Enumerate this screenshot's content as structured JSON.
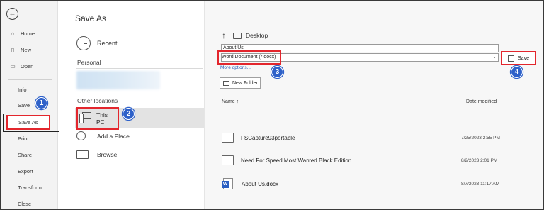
{
  "nav": {
    "items": [
      {
        "label": "Home",
        "icon": "home-icon",
        "glyph": "⌂"
      },
      {
        "label": "New",
        "icon": "new-document-icon",
        "glyph": "▯"
      },
      {
        "label": "Open",
        "icon": "open-folder-icon",
        "glyph": "▭"
      },
      {
        "label": "Info"
      },
      {
        "label": "Save"
      },
      {
        "label": "Save As"
      },
      {
        "label": "Print"
      },
      {
        "label": "Share"
      },
      {
        "label": "Export"
      },
      {
        "label": "Transform"
      },
      {
        "label": "Close"
      }
    ],
    "back_glyph": "←"
  },
  "page": {
    "title": "Save As"
  },
  "locations": {
    "recent": "Recent",
    "personal_header": "Personal",
    "other_header": "Other locations",
    "this_pc": "This PC",
    "add_place": "Add a Place",
    "browse": "Browse"
  },
  "save_panel": {
    "up_glyph": "↑",
    "current_path": "Desktop",
    "file_name": "About Us",
    "file_type": "Word Document (*.docx)",
    "dropdown_glyph": "⌄",
    "more_options": "More options...",
    "save_button": "Save",
    "new_folder": "New Folder",
    "columns": {
      "name": "Name ↑",
      "date": "Date modified"
    },
    "files": [
      {
        "name": "FSCapture93portable",
        "date": "7/25/2023 2:55 PM",
        "kind": "folder"
      },
      {
        "name": "Need For Speed Most Wanted Black Edition",
        "date": "8/2/2023 2:01 PM",
        "kind": "folder"
      },
      {
        "name": "About Us.docx",
        "date": "8/7/2023 11:17 AM",
        "kind": "word"
      }
    ]
  },
  "badges": [
    "1",
    "2",
    "3",
    "4"
  ],
  "colors": {
    "highlight": "#e3262d",
    "badge": "#2e61c9",
    "selected_row": "#e3e3e3"
  }
}
